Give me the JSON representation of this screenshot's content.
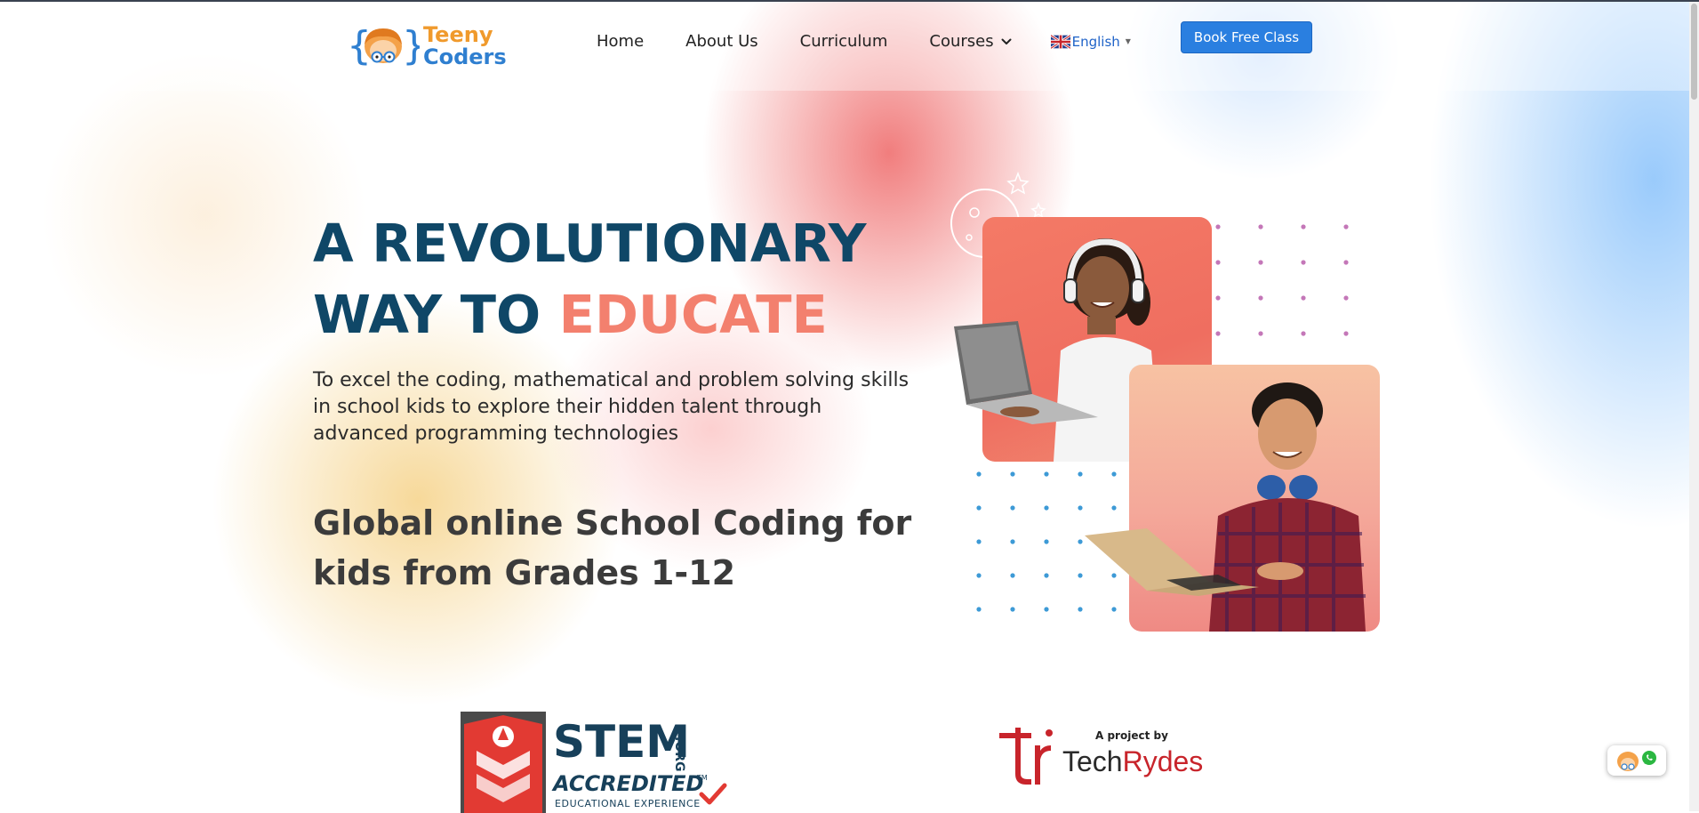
{
  "brand": {
    "name_line1": "Teeny",
    "name_line2": "Coders"
  },
  "nav": {
    "items": [
      {
        "label": "Home"
      },
      {
        "label": "About Us"
      },
      {
        "label": "Curriculum"
      },
      {
        "label": "Courses"
      }
    ],
    "language": "English",
    "cta_label": "Book Free Class"
  },
  "hero": {
    "title_line1": "A REVOLUTIONARY",
    "title_line2_prefix": "WAY TO",
    "title_line2_accent": "EDUCATE",
    "subtitle": "To excel the coding, mathematical and problem solving skills in school kids to explore their hidden talent through advanced programming technologies",
    "tagline": "Global online School Coding for kids from Grades 1-12"
  },
  "partners": {
    "stem_main": "STEM",
    "stem_org": ".ORG",
    "stem_accredited": "ACCREDITED",
    "stem_tm": "TM",
    "stem_sub": "EDUCATIONAL EXPERIENCE",
    "project_by": "A project by",
    "techrydes_part1": "Tech",
    "techrydes_part2": "Rydes"
  },
  "colors": {
    "title_navy": "#0f4767",
    "accent_coral": "#f3806e",
    "cta_blue": "#2a7fe0",
    "brand_orange": "#f09a2c",
    "brand_blue": "#2f7fd0"
  },
  "icons": {
    "logo": "teeny-coders-mascot-icon",
    "courses_dropdown": "chevron-down-icon",
    "language_flag": "uk-flag-icon",
    "chat": "whatsapp-icon"
  }
}
